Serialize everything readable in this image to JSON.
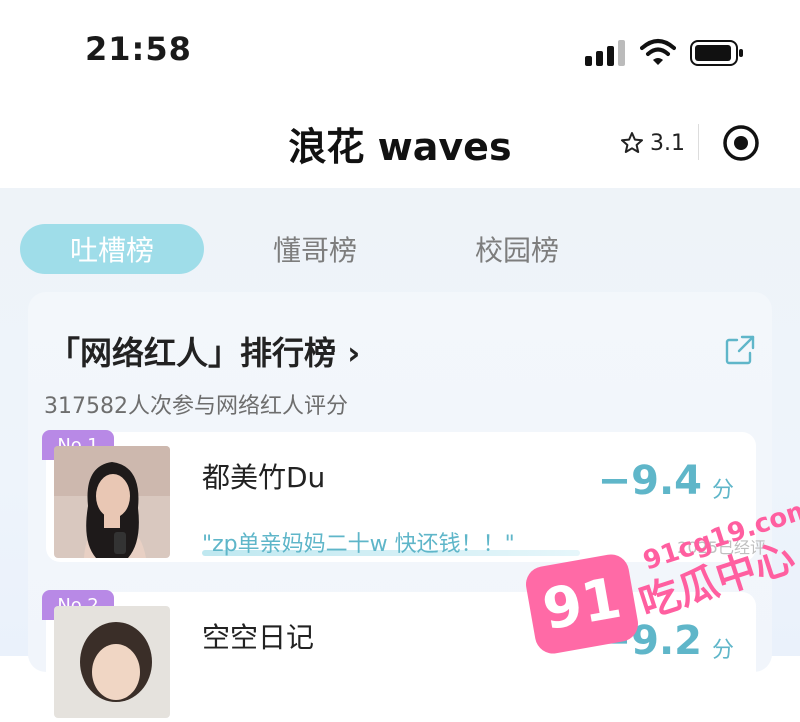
{
  "status_bar": {
    "time": "21:58"
  },
  "header": {
    "title": "浪花 waves",
    "rating": "3.1"
  },
  "tabs": [
    {
      "label": "吐槽榜",
      "active": true
    },
    {
      "label": "懂哥榜",
      "active": false
    },
    {
      "label": "校园榜",
      "active": false
    }
  ],
  "ranking": {
    "title": "「网络红人」排行榜 ›",
    "subtitle": "317582人次参与网络红人评分",
    "items": [
      {
        "rank": "No.1",
        "name": "都美竹Du",
        "quote": "\"zp单亲妈妈二十w 快还钱！！\"",
        "score": "−9.4",
        "unit": "分",
        "meta": "2025已经评"
      },
      {
        "rank": "No.2",
        "name": "空空日记",
        "score": "−9.2",
        "unit": "分"
      }
    ]
  },
  "watermark": {
    "logo": "91",
    "url": "91cg19.com",
    "label": "吃瓜中心"
  },
  "colors": {
    "accent": "#5fb6c9",
    "tab_active_bg": "#9fdde9",
    "badge": "#b889e6",
    "watermark": "#ff5fa0"
  }
}
